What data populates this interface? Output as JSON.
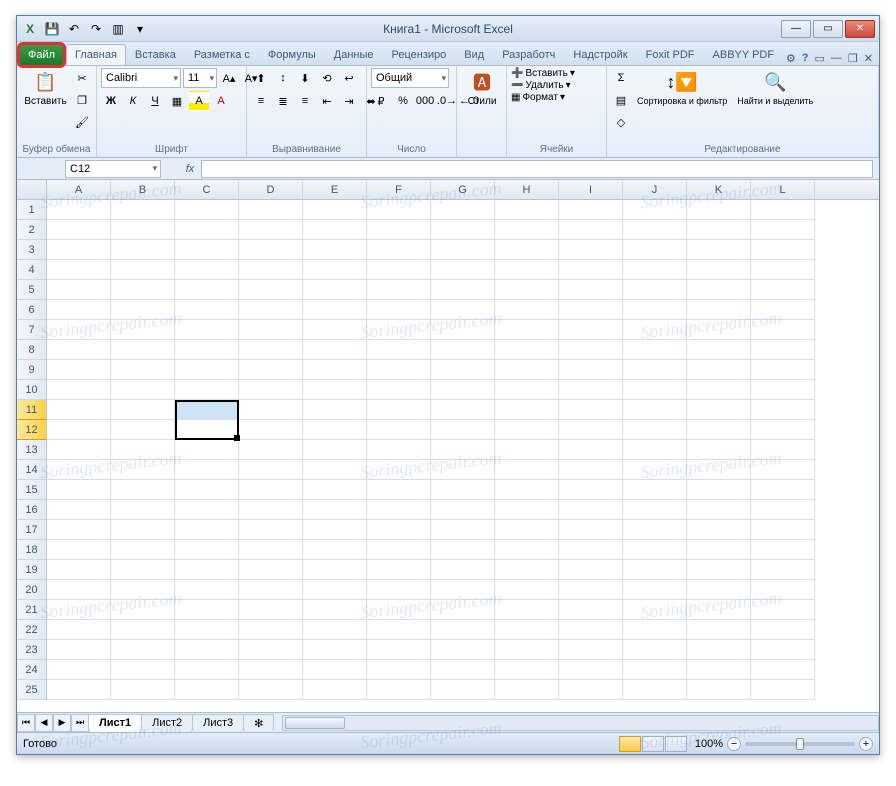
{
  "window": {
    "title": "Книга1 - Microsoft Excel",
    "qat": {
      "excel": "X",
      "save": "💾",
      "undo": "↶",
      "redo": "↷",
      "newdoc": "▥",
      "customize": "▾"
    }
  },
  "tabs": {
    "file": "Файл",
    "items": [
      "Главная",
      "Вставка",
      "Разметка с",
      "Формулы",
      "Данные",
      "Рецензиро",
      "Вид",
      "Разработч",
      "Надстройк",
      "Foxit PDF",
      "ABBYY PDF"
    ],
    "help": "?"
  },
  "ribbon": {
    "clipboard": {
      "paste": "Вставить",
      "label": "Буфер обмена"
    },
    "font": {
      "name": "Calibri",
      "size": "11",
      "bold": "Ж",
      "italic": "К",
      "underline": "Ч",
      "label": "Шрифт"
    },
    "align": {
      "label": "Выравнивание"
    },
    "number": {
      "format": "Общий",
      "label": "Число"
    },
    "styles": {
      "btn": "Стили",
      "label": ""
    },
    "cells": {
      "insert": "Вставить",
      "delete": "Удалить",
      "format": "Формат",
      "label": "Ячейки"
    },
    "editing": {
      "sort": "Сортировка и фильтр",
      "find": "Найти и выделить",
      "label": "Редактирование"
    }
  },
  "formula_bar": {
    "name_box": "C12",
    "fx": "fx"
  },
  "grid": {
    "columns": [
      "A",
      "B",
      "C",
      "D",
      "E",
      "F",
      "G",
      "H",
      "I",
      "J",
      "K",
      "L"
    ],
    "row_count": 25,
    "selected_rows": [
      11,
      12
    ],
    "selected_col_index": 2
  },
  "sheets": {
    "tabs": [
      "Лист1",
      "Лист2",
      "Лист3"
    ],
    "active": 0
  },
  "status": {
    "ready": "Готово",
    "zoom": "100%"
  },
  "watermark": "Soringpcrepair.com"
}
